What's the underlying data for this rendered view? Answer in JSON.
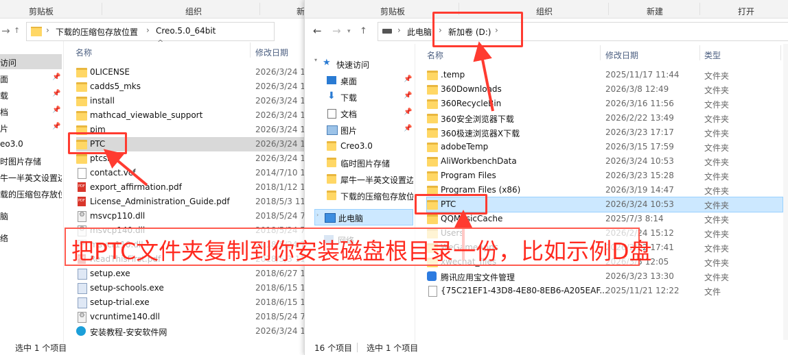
{
  "left_window": {
    "ribbon": [
      "剪贴板",
      "组织",
      "新"
    ],
    "breadcrumb": [
      "下载的压缩包存放位置",
      "Creo.5.0_64bit"
    ],
    "columns": {
      "name": "名称",
      "date": "修改日期"
    },
    "nav_items": [
      "访问",
      "面",
      "载",
      "档",
      "片",
      "eo3.0",
      "时图片存储",
      "牛一半英文设置边",
      "载的压缩包存放位",
      "脑",
      "络"
    ],
    "files": [
      {
        "name": "0LICENSE",
        "date": "2026/3/24 1",
        "icon": "folder"
      },
      {
        "name": "cadds5_mks",
        "date": "2026/3/24 1",
        "icon": "folder"
      },
      {
        "name": "install",
        "date": "2026/3/24 1",
        "icon": "folder"
      },
      {
        "name": "mathcad_viewable_support",
        "date": "2026/3/24 1",
        "icon": "folder"
      },
      {
        "name": "pim",
        "date": "2026/3/24 1",
        "icon": "folder"
      },
      {
        "name": "PTC",
        "date": "2026/3/24 1",
        "icon": "folder"
      },
      {
        "name": "ptcsh",
        "date": "2026/3/24 1",
        "icon": "folder"
      },
      {
        "name": "contact.vcf",
        "date": "2014/7/10 1",
        "icon": "file"
      },
      {
        "name": "export_affirmation.pdf",
        "date": "2018/1/12 1",
        "icon": "pdf"
      },
      {
        "name": "License_Administration_Guide.pdf",
        "date": "2018/5/3 11",
        "icon": "pdf"
      },
      {
        "name": "msvcp110.dll",
        "date": "2018/5/24 7",
        "icon": "dll"
      },
      {
        "name": "msvcp140.dll",
        "date": "2018/5/24 7",
        "icon": "dll"
      },
      {
        "name": "msvcr110.dll",
        "date": "2018/5/24 7",
        "icon": "dll"
      },
      {
        "name": "ReadThisFirst.pdf",
        "date": "2018/5/3 11",
        "icon": "pdf"
      },
      {
        "name": "setup.exe",
        "date": "2018/6/27 1",
        "icon": "exe"
      },
      {
        "name": "setup-schools.exe",
        "date": "2018/6/15 1",
        "icon": "exe"
      },
      {
        "name": "setup-trial.exe",
        "date": "2018/6/15 1",
        "icon": "exe"
      },
      {
        "name": "vcruntime140.dll",
        "date": "2018/5/24 7",
        "icon": "dll"
      },
      {
        "name": "安装教程-安安软件网",
        "date": "2026/3/24 1",
        "icon": "web"
      }
    ],
    "status": "选中 1 个项目"
  },
  "right_window": {
    "ribbon": [
      "剪贴板",
      "组织",
      "新建",
      "打开"
    ],
    "breadcrumb": [
      "此电脑",
      "新加卷 (D:)"
    ],
    "columns": {
      "name": "名称",
      "date": "修改日期",
      "type": "类型"
    },
    "nav": {
      "quick_access": "快速访问",
      "items": [
        "桌面",
        "下载",
        "文档",
        "图片",
        "Creo3.0",
        "临时图片存储",
        "犀牛一半英文设置边",
        "下载的压缩包存放位"
      ],
      "this_pc": "此电脑",
      "network": "网络"
    },
    "files": [
      {
        "name": ".temp",
        "date": "2025/11/17 11:44",
        "type": "文件夹",
        "icon": "folder"
      },
      {
        "name": "360Downloads",
        "date": "2026/3/8 12:49",
        "type": "文件夹",
        "icon": "folder"
      },
      {
        "name": "360RecycleBin",
        "date": "2026/3/16 11:56",
        "type": "文件夹",
        "icon": "folder"
      },
      {
        "name": "360安全浏览器下载",
        "date": "2026/2/22 13:49",
        "type": "文件夹",
        "icon": "folder"
      },
      {
        "name": "360极速浏览器X下载",
        "date": "2026/3/23 17:17",
        "type": "文件夹",
        "icon": "folder"
      },
      {
        "name": "adobeTemp",
        "date": "2026/3/15 17:59",
        "type": "文件夹",
        "icon": "folder"
      },
      {
        "name": "AliWorkbenchData",
        "date": "2026/3/24 10:53",
        "type": "文件夹",
        "icon": "folder"
      },
      {
        "name": "Program Files",
        "date": "2026/3/23 15:28",
        "type": "文件夹",
        "icon": "folder"
      },
      {
        "name": "Program Files (x86)",
        "date": "2026/3/19 14:47",
        "type": "文件夹",
        "icon": "folder"
      },
      {
        "name": "PTC",
        "date": "2026/3/24 10:53",
        "type": "文件夹",
        "icon": "folder"
      },
      {
        "name": "QQMusicCache",
        "date": "2025/7/3 8:14",
        "type": "文件夹",
        "icon": "folder"
      },
      {
        "name": "Users",
        "date": "2026/2/24 15:12",
        "type": "文件夹",
        "icon": "folder"
      },
      {
        "name": "WeGameApps",
        "date": "2026/2/22 17:41",
        "type": "文件夹",
        "icon": "folder"
      },
      {
        "name": "xwechat_files",
        "date": "2026/3/5 12:05",
        "type": "文件夹",
        "icon": "folder"
      },
      {
        "name": "腾讯应用宝文件管理",
        "date": "2026/3/23 13:30",
        "type": "文件夹",
        "icon": "app"
      },
      {
        "name": "{75C21EF1-43D8-4E80-8EB6-A205EAF...",
        "date": "2025/11/21 12:22",
        "type": "文件",
        "icon": "file"
      }
    ],
    "status_count": "16 个项目",
    "status_selected": "选中 1 个项目"
  },
  "annotation": {
    "text": "把PTC文件夹复制到你安装磁盘根目录一份，比如示例D盘",
    "color": "#ff2a1f"
  }
}
